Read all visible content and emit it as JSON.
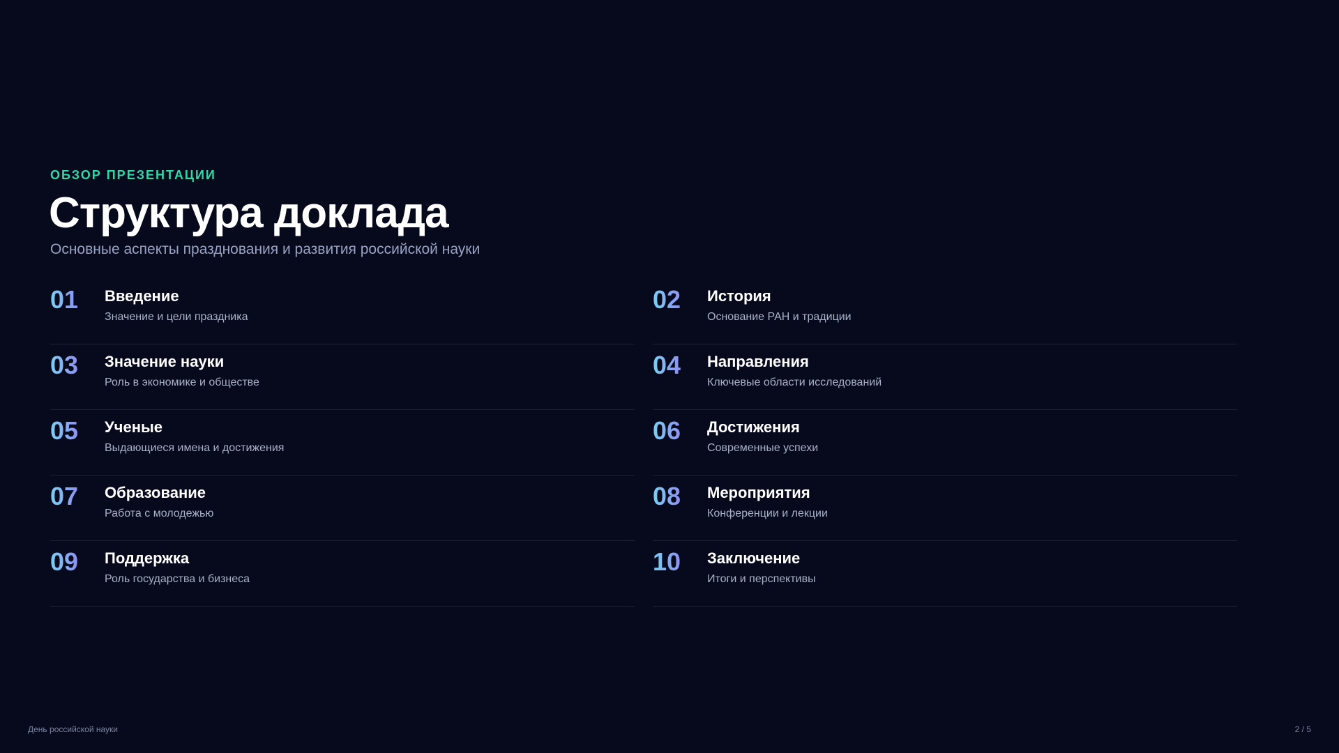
{
  "header": {
    "eyebrow": "ОБЗОР ПРЕЗЕНТАЦИИ",
    "title": "Структура доклада",
    "subtitle": "Основные аспекты празднования и развития российской науки"
  },
  "items": [
    {
      "num": "01",
      "title": "Введение",
      "desc": "Значение и цели праздника"
    },
    {
      "num": "02",
      "title": "История",
      "desc": "Основание РАН и традиции"
    },
    {
      "num": "03",
      "title": "Значение науки",
      "desc": "Роль в экономике и обществе"
    },
    {
      "num": "04",
      "title": "Направления",
      "desc": "Ключевые области исследований"
    },
    {
      "num": "05",
      "title": "Ученые",
      "desc": "Выдающиеся имена и достижения"
    },
    {
      "num": "06",
      "title": "Достижения",
      "desc": "Современные успехи"
    },
    {
      "num": "07",
      "title": "Образование",
      "desc": "Работа с молодежью"
    },
    {
      "num": "08",
      "title": "Мероприятия",
      "desc": "Конференции и лекции"
    },
    {
      "num": "09",
      "title": "Поддержка",
      "desc": "Роль государства и бизнеса"
    },
    {
      "num": "10",
      "title": "Заключение",
      "desc": "Итоги и перспективы"
    }
  ],
  "footer": {
    "left": "День российской науки",
    "page": "2 / 5"
  },
  "colors": {
    "background": "#070a1c",
    "accent": "#34d8a6",
    "number_gradient_start": "#7ad0f4",
    "number_gradient_end": "#8f8ff0"
  }
}
